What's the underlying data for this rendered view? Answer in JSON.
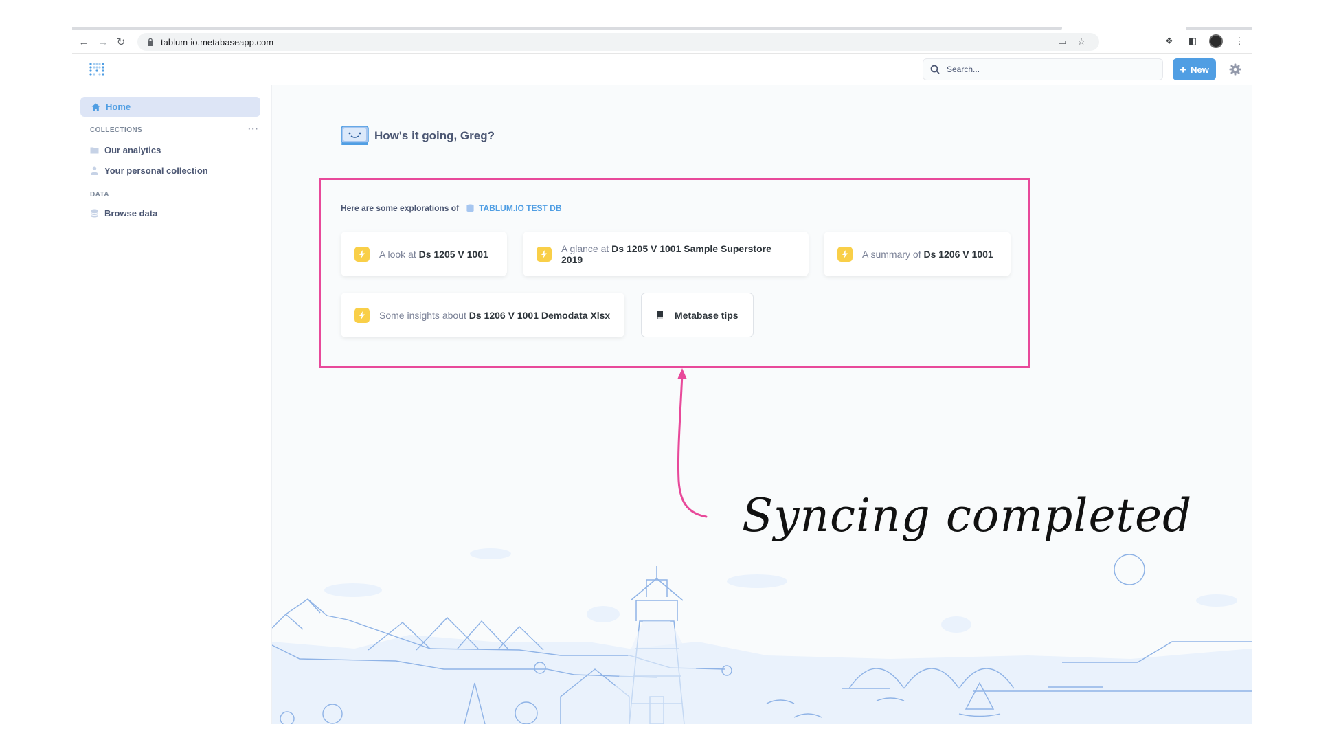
{
  "browser": {
    "url": "tablum-io.metabaseapp.com"
  },
  "header": {
    "search_placeholder": "Search...",
    "new_label": "New"
  },
  "sidebar": {
    "home_label": "Home",
    "collections_title": "COLLECTIONS",
    "collections": [
      {
        "label": "Our analytics",
        "icon": "folder-icon"
      },
      {
        "label": "Your personal collection",
        "icon": "person-icon"
      }
    ],
    "data_title": "DATA",
    "data_items": [
      {
        "label": "Browse data",
        "icon": "database-icon"
      }
    ]
  },
  "main": {
    "greeting": "How's it going, Greg?",
    "explorations_prefix": "Here are some explorations of",
    "database_name": "TABLUM.IO TEST DB",
    "cards": [
      {
        "prefix": "A look at",
        "name": "Ds 1205 V 1001"
      },
      {
        "prefix": "A glance at",
        "name": "Ds 1205 V 1001 Sample Superstore 2019"
      },
      {
        "prefix": "A summary of",
        "name": "Ds 1206 V 1001"
      },
      {
        "prefix": "Some insights about",
        "name": "Ds 1206 V 1001 Demodata Xlsx"
      }
    ],
    "tips_label": "Metabase tips"
  },
  "annotation": {
    "text": "Syncing completed"
  },
  "colors": {
    "brand": "#509ee3",
    "highlight": "#e8499a",
    "bolt": "#f9cf48"
  }
}
